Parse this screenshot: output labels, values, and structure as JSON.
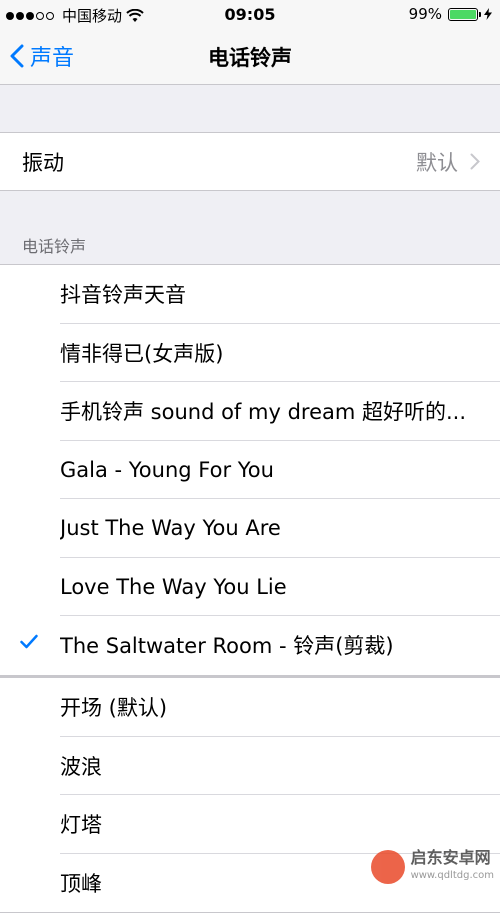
{
  "status_bar": {
    "carrier": "中国移动",
    "time": "09:05",
    "battery": "99%",
    "battery_level": 0.99
  },
  "nav": {
    "back_label": "声音",
    "title": "电话铃声"
  },
  "vibration": {
    "label": "振动",
    "value": "默认"
  },
  "section": {
    "header": "电话铃声"
  },
  "ringtones": [
    {
      "label": "抖音铃声天音",
      "selected": false
    },
    {
      "label": "情非得已(女声版)",
      "selected": false
    },
    {
      "label": "手机铃声 sound of my dream 超好听的...",
      "selected": false
    },
    {
      "label": "Gala - Young For You",
      "selected": false
    },
    {
      "label": "Just The Way You Are",
      "selected": false
    },
    {
      "label": "Love The Way You Lie",
      "selected": false
    },
    {
      "label": "The Saltwater Room - 铃声(剪裁)",
      "selected": true
    }
  ],
  "builtin": [
    {
      "label": "开场 (默认)"
    },
    {
      "label": "波浪"
    },
    {
      "label": "灯塔"
    },
    {
      "label": "顶峰"
    }
  ],
  "watermark": {
    "name": "启东安卓网",
    "url": "www.qdltdg.com"
  },
  "colors": {
    "accent": "#007aff",
    "background": "#efeff4",
    "battery": "#4cd964"
  }
}
